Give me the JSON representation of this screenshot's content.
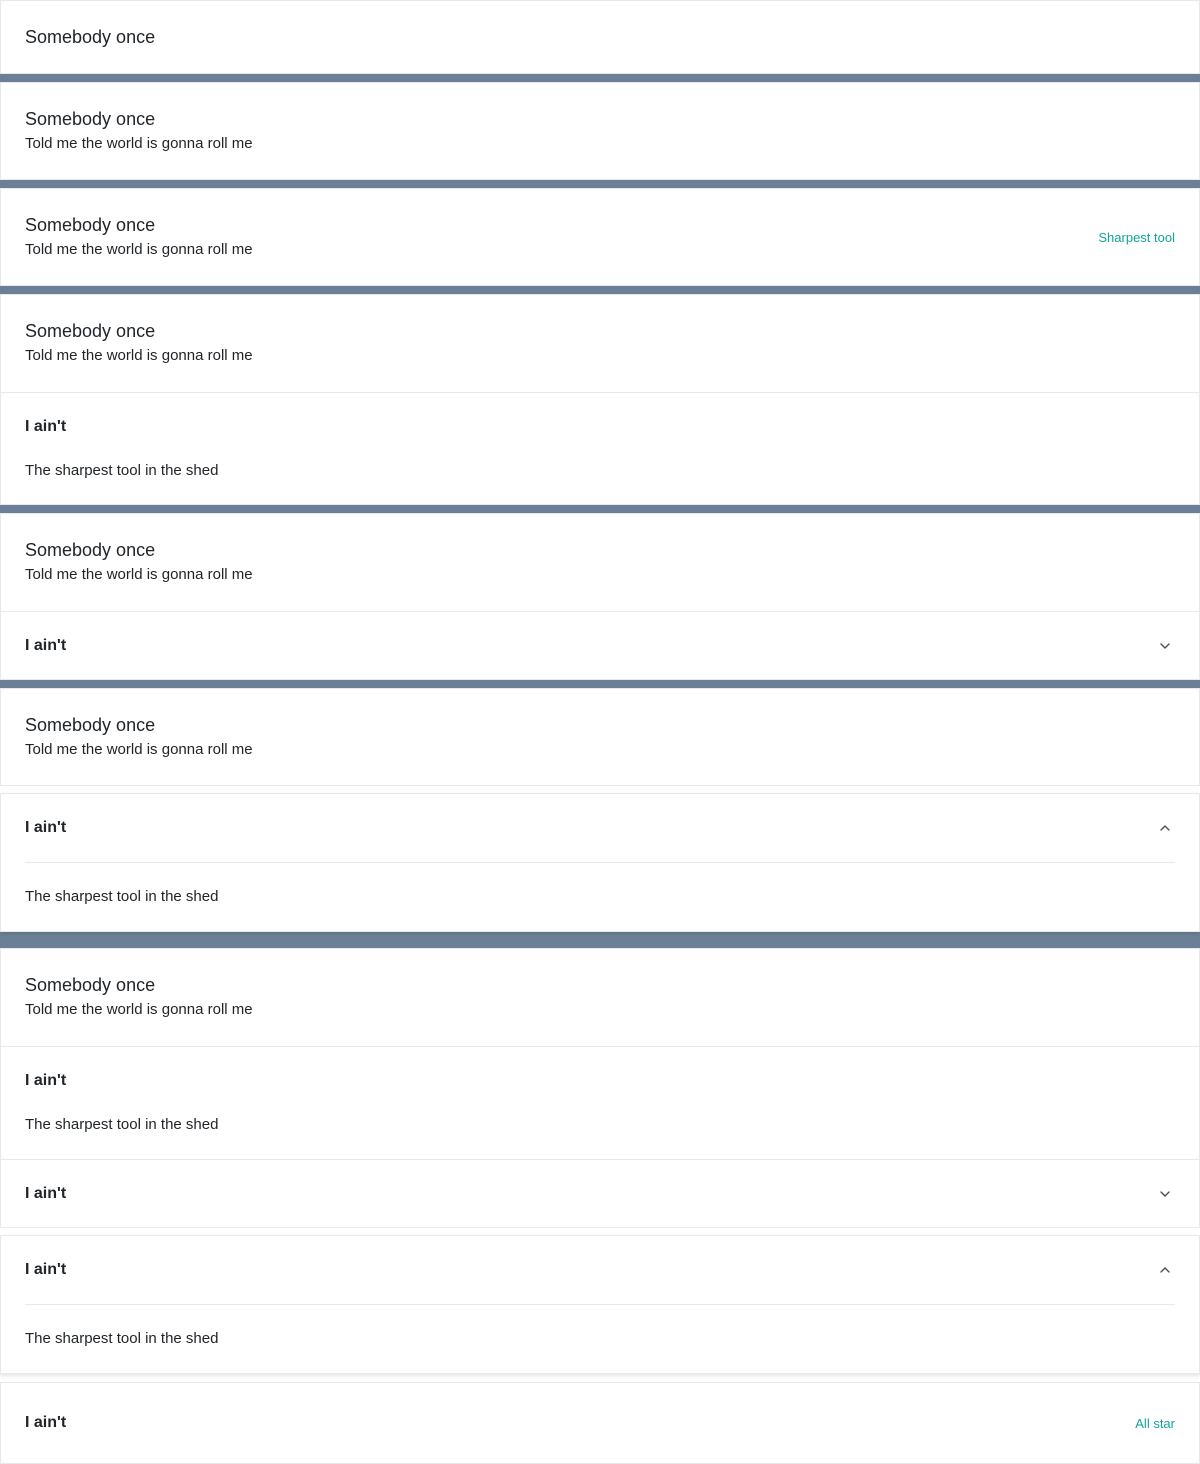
{
  "colors": {
    "background": "#6b7f96",
    "card": "#ffffff",
    "border": "#e6e8eb",
    "text": "#212529",
    "accent": "#12a596"
  },
  "header": {
    "title": "Somebody once",
    "subtitle": "Told me the world is gonna roll me"
  },
  "section": {
    "title": "I ain't",
    "body": "The sharpest tool in the shed"
  },
  "actions": {
    "sharpest_tool": "Sharpest tool",
    "all_star": "All star"
  },
  "icons": {
    "collapsed": "chevron-down-icon",
    "expanded": "chevron-up-icon"
  }
}
